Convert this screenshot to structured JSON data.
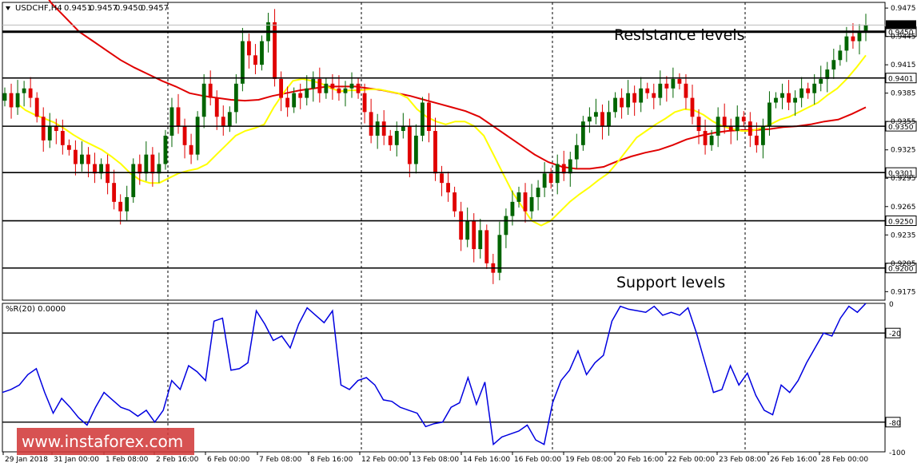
{
  "chart_data": {
    "type": "candlestick",
    "header": {
      "symbol_timeframe": "USDCHF,H4",
      "ohlc": [
        "0.9451",
        "0.9457",
        "0.9450",
        "0.9457"
      ]
    },
    "y_ticks": [
      "0.9475",
      "0.9445",
      "0.9415",
      "0.9385",
      "0.9355",
      "0.9325",
      "0.9295",
      "0.9265",
      "0.9235",
      "0.9205",
      "0.9175"
    ],
    "ylim": [
      0.9166,
      0.9481
    ],
    "horizontal_levels": [
      {
        "value": 0.945,
        "label": "0.9450"
      },
      {
        "value": 0.9401,
        "label": "0.9401"
      },
      {
        "value": 0.935,
        "label": "0.9350"
      },
      {
        "value": 0.9301,
        "label": "0.9301"
      },
      {
        "value": 0.925,
        "label": "0.9250"
      },
      {
        "value": 0.92,
        "label": "0.9200"
      }
    ],
    "current_price_label": "0.9457",
    "annotations": {
      "resistance": "Resistance levels",
      "support": "Support levels"
    },
    "x_labels": [
      "29 Jan 2018",
      "31 Jan 00:00",
      "1 Feb 08:00",
      "2 Feb 16:00",
      "6 Feb 00:00",
      "7 Feb 08:00",
      "8 Feb 16:00",
      "12 Feb 00:00",
      "13 Feb 08:00",
      "14 Feb 16:00",
      "16 Feb 00:00",
      "19 Feb 08:00",
      "20 Feb 16:00",
      "22 Feb 00:00",
      "23 Feb 08:00",
      "26 Feb 16:00",
      "28 Feb 00:00"
    ],
    "close_path": [
      0.9385,
      0.937,
      0.9385,
      0.939,
      0.938,
      0.936,
      0.9335,
      0.935,
      0.9345,
      0.933,
      0.9325,
      0.931,
      0.932,
      0.931,
      0.93,
      0.931,
      0.929,
      0.927,
      0.926,
      0.9275,
      0.931,
      0.93,
      0.932,
      0.93,
      0.931,
      0.934,
      0.937,
      0.935,
      0.933,
      0.932,
      0.936,
      0.9395,
      0.938,
      0.936,
      0.935,
      0.9365,
      0.9395,
      0.944,
      0.9425,
      0.9415,
      0.944,
      0.946,
      0.94,
      0.938,
      0.937,
      0.9385,
      0.938,
      0.939,
      0.94,
      0.9385,
      0.9395,
      0.939,
      0.9385,
      0.939,
      0.9395,
      0.9385,
      0.9365,
      0.934,
      0.9355,
      0.934,
      0.933,
      0.9345,
      0.935,
      0.931,
      0.934,
      0.9375,
      0.9345,
      0.93,
      0.929,
      0.928,
      0.926,
      0.923,
      0.925,
      0.922,
      0.924,
      0.9205,
      0.9195,
      0.9235,
      0.9255,
      0.927,
      0.928,
      0.926,
      0.9275,
      0.9285,
      0.93,
      0.929,
      0.931,
      0.93,
      0.9315,
      0.933,
      0.9355,
      0.936,
      0.9365,
      0.935,
      0.9365,
      0.938,
      0.937,
      0.9385,
      0.9375,
      0.939,
      0.9385,
      0.938,
      0.9395,
      0.939,
      0.94,
      0.9395,
      0.938,
      0.936,
      0.9345,
      0.933,
      0.934,
      0.936,
      0.935,
      0.9345,
      0.936,
      0.9355,
      0.934,
      0.933,
      0.935,
      0.9375,
      0.938,
      0.9385,
      0.9375,
      0.938,
      0.939,
      0.9385,
      0.9395,
      0.94,
      0.941,
      0.942,
      0.943,
      0.9445,
      0.944,
      0.945,
      0.9457
    ],
    "ma_fast": {
      "color": "#ffff00",
      "values": [
        0.9375,
        0.9367,
        0.9362,
        0.9358,
        0.9354,
        0.9348,
        0.9341,
        0.9335,
        0.933,
        0.9325,
        0.9318,
        0.931,
        0.93,
        0.9293,
        0.929,
        0.929,
        0.9295,
        0.93,
        0.9303,
        0.9305,
        0.931,
        0.932,
        0.933,
        0.934,
        0.9345,
        0.9348,
        0.9352,
        0.937,
        0.9385,
        0.9398,
        0.94,
        0.9398,
        0.9395,
        0.939,
        0.9387,
        0.9388,
        0.9388,
        0.9389,
        0.9389,
        0.9387,
        0.9385,
        0.938,
        0.9368,
        0.936,
        0.9355,
        0.9352,
        0.9355,
        0.9355,
        0.935,
        0.934,
        0.932,
        0.93,
        0.928,
        0.9265,
        0.925,
        0.9245,
        0.925,
        0.926,
        0.927,
        0.9278,
        0.9285,
        0.9293,
        0.93,
        0.9312,
        0.9325,
        0.9338,
        0.9345,
        0.9352,
        0.9358,
        0.9365,
        0.9368,
        0.9367,
        0.9362,
        0.9355,
        0.935,
        0.9347,
        0.9345,
        0.9345,
        0.9348,
        0.9352,
        0.9357,
        0.936,
        0.9365,
        0.937,
        0.9375,
        0.9383,
        0.939,
        0.94,
        0.9412,
        0.9425
      ]
    },
    "ma_slow": {
      "color": "#e00000",
      "values": [
        0.952,
        0.95,
        0.948,
        0.9465,
        0.945,
        0.944,
        0.943,
        0.942,
        0.9412,
        0.9405,
        0.9398,
        0.9392,
        0.9385,
        0.9382,
        0.938,
        0.9378,
        0.9377,
        0.9378,
        0.9382,
        0.9385,
        0.9388,
        0.939,
        0.9392,
        0.9392,
        0.9392,
        0.939,
        0.9388,
        0.9385,
        0.9382,
        0.9378,
        0.9374,
        0.937,
        0.9366,
        0.936,
        0.935,
        0.934,
        0.933,
        0.932,
        0.9312,
        0.9307,
        0.9305,
        0.9305,
        0.9307,
        0.9313,
        0.9318,
        0.9322,
        0.9325,
        0.933,
        0.9336,
        0.934,
        0.9343,
        0.9345,
        0.9346,
        0.9346,
        0.9347,
        0.9349,
        0.935,
        0.9352,
        0.9355,
        0.9357,
        0.9363,
        0.937
      ]
    },
    "indicator": {
      "label": "%R(20) 0.0000",
      "ylim": [
        -100,
        0
      ],
      "levels": [
        -20,
        -80
      ],
      "tick_labels": [
        "0",
        "-20",
        "-80",
        "-100"
      ],
      "color": "#0000e0",
      "values": [
        -60,
        -58,
        -55,
        -48,
        -44,
        -60,
        -74,
        -64,
        -70,
        -77,
        -82,
        -70,
        -60,
        -65,
        -70,
        -72,
        -76,
        -72,
        -80,
        -72,
        -52,
        -58,
        -42,
        -46,
        -52,
        -12,
        -10,
        -45,
        -44,
        -40,
        -5,
        -14,
        -25,
        -22,
        -30,
        -14,
        -3,
        -8,
        -13,
        -5,
        -55,
        -58,
        -52,
        -50,
        -55,
        -65,
        -66,
        -70,
        -72,
        -74,
        -83,
        -81,
        -80,
        -70,
        -67,
        -50,
        -68,
        -53,
        -95,
        -90,
        -88,
        -86,
        -82,
        -92,
        -95,
        -67,
        -52,
        -45,
        -32,
        -48,
        -40,
        -35,
        -12,
        -2,
        -4,
        -5,
        -6,
        -2,
        -8,
        -6,
        -8,
        -3,
        -20,
        -40,
        -60,
        -58,
        -42,
        -55,
        -47,
        -62,
        -72,
        -75,
        -55,
        -60,
        -52,
        -40,
        -30,
        -20,
        -22,
        -10,
        -2,
        -6,
        0
      ]
    },
    "watermark": "www.instaforex.com"
  }
}
